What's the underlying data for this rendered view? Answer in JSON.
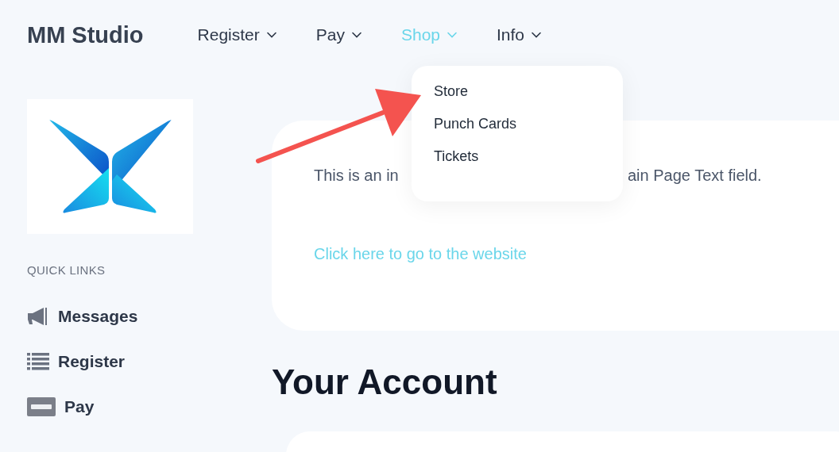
{
  "brand": "MM Studio",
  "nav": [
    {
      "label": "Register",
      "selected": false
    },
    {
      "label": "Pay",
      "selected": false
    },
    {
      "label": "Shop",
      "selected": true,
      "menu": [
        "Store",
        "Punch Cards",
        "Tickets"
      ]
    },
    {
      "label": "Info",
      "selected": false
    }
  ],
  "sidebar": {
    "heading": "QUICK LINKS",
    "items": [
      {
        "kind": "megaphone",
        "label": "Messages"
      },
      {
        "kind": "list",
        "label": "Register"
      },
      {
        "kind": "card",
        "label": "Pay"
      }
    ]
  },
  "intro": {
    "text_start": "This is an in",
    "text_end": "ain Page Text field.",
    "link": "Click here to go to the website"
  },
  "section_title": "Your Account"
}
